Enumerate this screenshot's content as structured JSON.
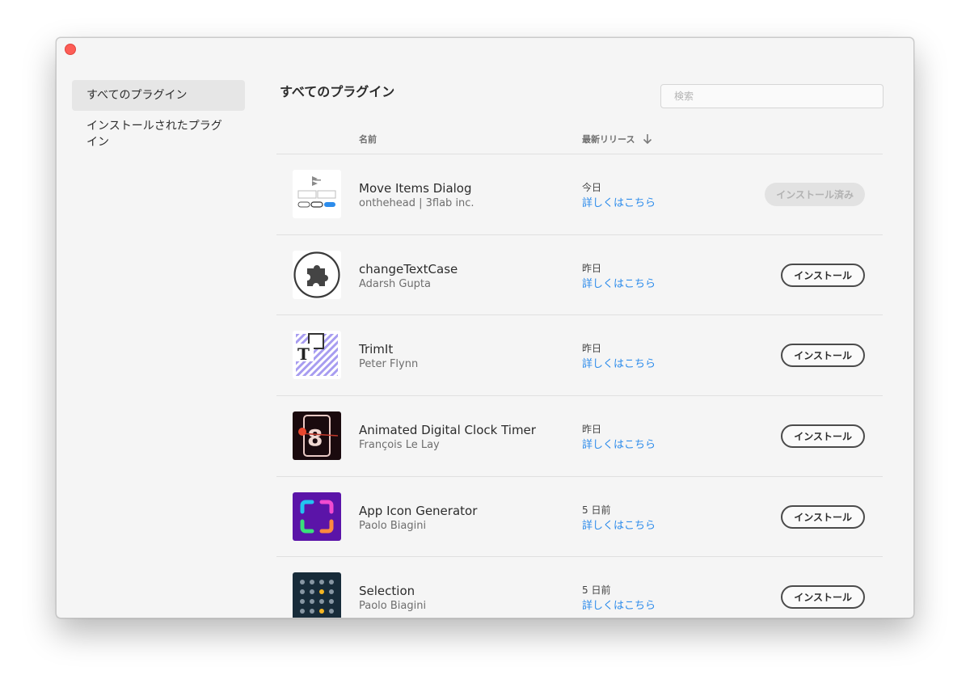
{
  "sidebar": {
    "items": [
      {
        "label": "すべてのプラグイン",
        "active": true
      },
      {
        "label": "インストールされたプラグイン",
        "active": false
      }
    ]
  },
  "main": {
    "title": "すべてのプラグイン",
    "search_placeholder": "検索",
    "columns": {
      "name": "名前",
      "release": "最新リリース"
    }
  },
  "colors": {
    "link": "#2d8ceb",
    "close": "#fd5d56"
  },
  "plugins": [
    {
      "name": "Move Items Dialog",
      "author": "onthehead | 3flab inc.",
      "date": "今日",
      "more": "詳しくはこちら",
      "button": "インストール済み",
      "installed": true,
      "icon": "move-items-dialog-icon"
    },
    {
      "name": "changeTextCase",
      "author": "Adarsh Gupta",
      "date": "昨日",
      "more": "詳しくはこちら",
      "button": "インストール",
      "installed": false,
      "icon": "puzzle-piece-icon"
    },
    {
      "name": "TrimIt",
      "author": "Peter Flynn",
      "date": "昨日",
      "more": "詳しくはこちら",
      "button": "インストール",
      "installed": false,
      "icon": "trimit-icon"
    },
    {
      "name": "Animated Digital Clock Timer",
      "author": "François Le Lay",
      "date": "昨日",
      "more": "詳しくはこちら",
      "button": "インストール",
      "installed": false,
      "icon": "digital-clock-icon"
    },
    {
      "name": "App Icon Generator",
      "author": "Paolo Biagini",
      "date": "5 日前",
      "more": "詳しくはこちら",
      "button": "インストール",
      "installed": false,
      "icon": "app-icon-generator-icon"
    },
    {
      "name": "Selection",
      "author": "Paolo Biagini",
      "date": "5 日前",
      "more": "詳しくはこちら",
      "button": "インストール",
      "installed": false,
      "icon": "selection-dots-icon"
    }
  ]
}
